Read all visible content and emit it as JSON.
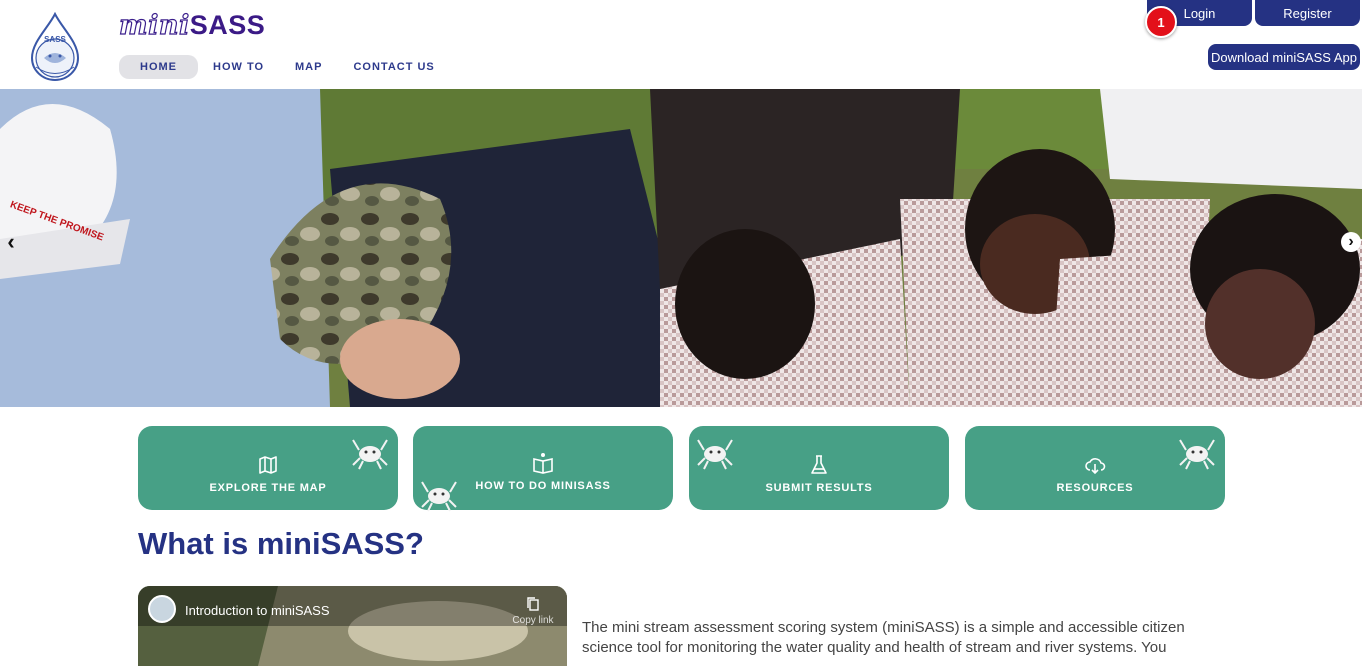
{
  "brand": {
    "mini": "mini",
    "sass": "SASS"
  },
  "nav": {
    "items": [
      {
        "label": "HOME",
        "active": true
      },
      {
        "label": "HOW TO",
        "active": false
      },
      {
        "label": "MAP",
        "active": false
      },
      {
        "label": "CONTACT US",
        "active": false
      }
    ]
  },
  "auth": {
    "login": "Login",
    "register": "Register",
    "badge": "1",
    "download": "Download miniSASS App"
  },
  "cards": [
    {
      "label": "EXPLORE THE MAP",
      "icon": "map-icon"
    },
    {
      "label": "HOW TO DO MINISASS",
      "icon": "book-icon"
    },
    {
      "label": "SUBMIT RESULTS",
      "icon": "flask-icon"
    },
    {
      "label": "RESOURCES",
      "icon": "cloud-download-icon"
    }
  ],
  "section": {
    "title": "What is miniSASS?"
  },
  "video": {
    "title": "Introduction to miniSASS",
    "copy_label": "Copy link"
  },
  "intro": {
    "text": "The mini stream assessment scoring system (miniSASS) is a simple and accessible citizen science tool for monitoring the water quality and health of stream and river systems. You"
  },
  "colors": {
    "primary": "#253283",
    "card": "#47a086",
    "badge": "#e3101a"
  }
}
